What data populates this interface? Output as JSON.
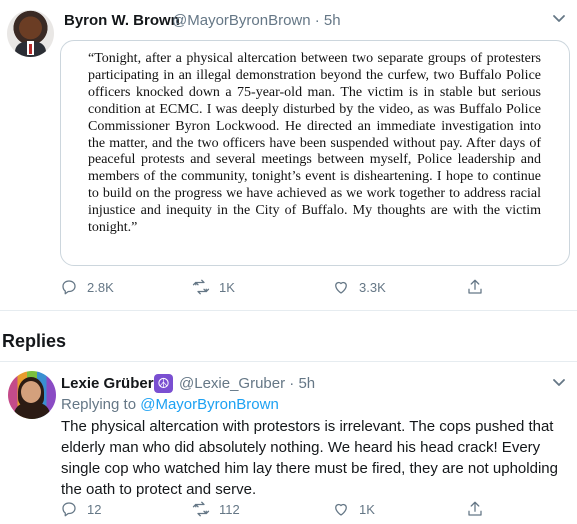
{
  "tweet": {
    "author_name": "Byron W. Brown",
    "author_handle": "@MayorByronBrown · 5h",
    "quote": "“Tonight, after a physical altercation between two separate groups of protesters participating in an illegal demonstration beyond the curfew, two Buffalo Police officers knocked down a 75-year-old man. The victim is in stable but serious condition at ECMC. I was deeply disturbed by the video, as was Buffalo Police Commissioner Byron Lockwood. He directed an immediate investigation into the matter, and the two officers have been suspended without pay. After days of peaceful protests and several meetings between myself, Police leadership and members of the community, tonight’s event is disheartening. I hope to continue to build on the progress we have achieved as we work together to address racial injustice and inequity in the City of Buffalo. My thoughts are with the victim tonight.”",
    "actions": {
      "replies": "2.8K",
      "retweets": "1K",
      "likes": "3.3K"
    }
  },
  "replies_section": {
    "heading": "Replies"
  },
  "reply": {
    "author_name": "Lexie Grüber",
    "author_badge": "☮",
    "author_handle": "@Lexie_Gruber · 5h",
    "replying_prefix": "Replying to",
    "replying_to": "@MayorByronBrown",
    "body": "The physical altercation with protestors is irrelevant. The cops pushed that elderly man who did absolutely nothing. We heard his head crack! Every single cop who watched him lay there must be fired, they are not upholding the oath to protect and serve.",
    "actions": {
      "replies": "12",
      "retweets": "112",
      "likes": "1K"
    }
  },
  "icons": {
    "reply": "reply-icon",
    "retweet": "retweet-icon",
    "like": "heart-icon",
    "share": "share-icon",
    "more": "chevron-down-icon"
  },
  "colors": {
    "muted": "#657786",
    "link": "#1da1f2",
    "border": "#e6ecf0"
  }
}
